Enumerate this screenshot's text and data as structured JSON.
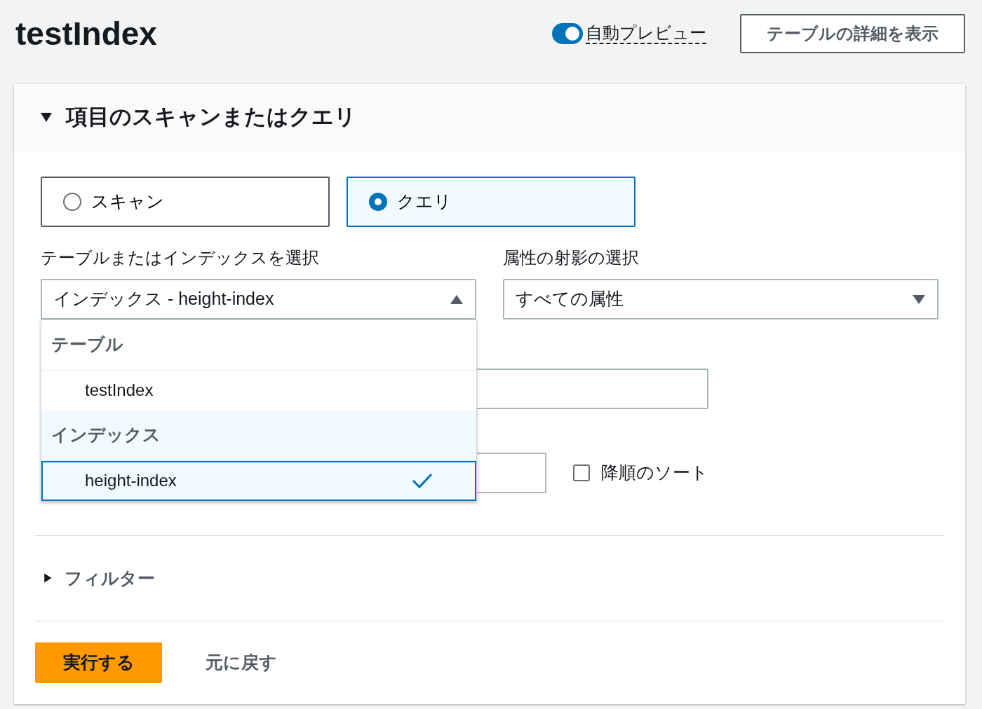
{
  "page": {
    "title": "testIndex",
    "auto_preview": {
      "label": "自動プレビュー",
      "on": true
    },
    "details_button": "テーブルの詳細を表示"
  },
  "panel": {
    "title": "項目のスキャンまたはクエリ",
    "expanded": true,
    "modes": [
      {
        "label": "スキャン",
        "selected": false
      },
      {
        "label": "クエリ",
        "selected": true
      }
    ],
    "table_select": {
      "label": "テーブルまたはインデックスを選択",
      "value": "インデックス - height-index",
      "expanded": true,
      "groups": [
        {
          "label": "テーブル",
          "children": [
            {
              "label": "testIndex",
              "selected": false
            }
          ]
        },
        {
          "label": "インデックス",
          "children": [
            {
              "label": "height-index",
              "selected": true
            }
          ]
        }
      ]
    },
    "projection_select": {
      "label": "属性の射影の選択",
      "value": "すべての属性",
      "expanded": false
    },
    "sort_descending": {
      "label": "降順のソート",
      "checked": false
    },
    "filter": {
      "label": "フィルター",
      "expanded": false
    },
    "run_button": "実行する",
    "reset_link": "元に戻す"
  }
}
